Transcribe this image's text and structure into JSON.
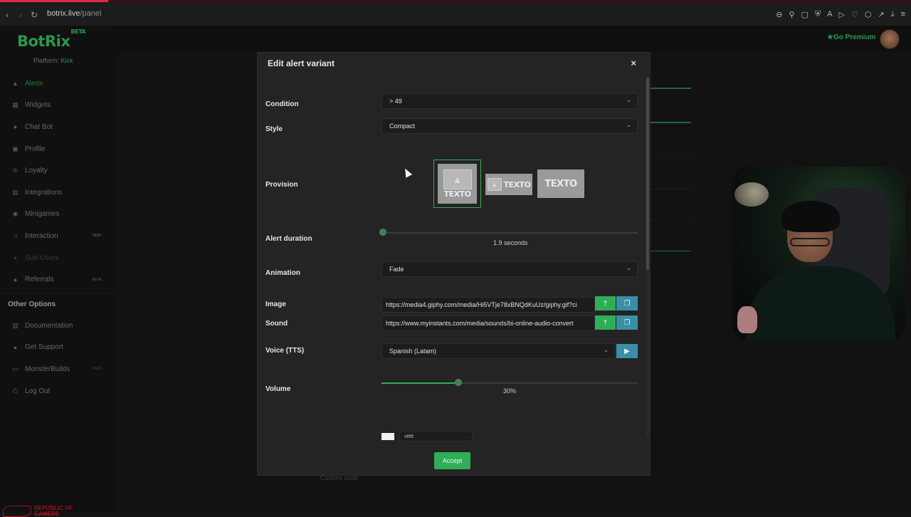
{
  "browser": {
    "url_host": "botrix.live",
    "url_path": "/panel"
  },
  "app": {
    "logo": "BotRix",
    "logo_badge": "BETA",
    "platform_label": "Platform:",
    "platform_value": "Kick",
    "go_premium": "Go Premium"
  },
  "sidebar": {
    "items": [
      {
        "label": "Alerts",
        "icon": "triangle-icon",
        "state": "active"
      },
      {
        "label": "Widgets",
        "icon": "widgets-icon"
      },
      {
        "label": "Chat Bot",
        "icon": "chat-icon"
      },
      {
        "label": "Profile",
        "icon": "profile-icon"
      },
      {
        "label": "Loyalty",
        "icon": "trophy-icon"
      },
      {
        "label": "Integrations",
        "icon": "integrations-icon"
      },
      {
        "label": "Minigames",
        "icon": "gamepad-icon"
      },
      {
        "label": "Interaction",
        "icon": "music-icon",
        "tag": "NEW"
      },
      {
        "label": "Sub-Users",
        "icon": "users-icon",
        "state": "dim"
      },
      {
        "label": "Referrals",
        "icon": "referrals-icon",
        "tag": "BETA"
      }
    ],
    "other_title": "Other Options",
    "other_items": [
      {
        "label": "Documentation",
        "icon": "document-icon"
      },
      {
        "label": "Get Support",
        "icon": "support-icon"
      },
      {
        "label": "MonsterBuilds",
        "icon": "monitor-icon",
        "tag": "ASUS"
      },
      {
        "label": "Log Out",
        "icon": "power-icon"
      }
    ]
  },
  "background": {
    "custom_code": "Custom code"
  },
  "modal": {
    "title": "Edit alert variant",
    "close": "×",
    "condition_label": "Condition",
    "condition_value": "> 49",
    "style_label": "Style",
    "style_value": "Compact",
    "provision_label": "Provision",
    "provision_cards": [
      "TEXTO",
      "TEXTO",
      "TEXTO"
    ],
    "duration_label": "Alert duration",
    "duration_value": "1.9 seconds",
    "duration_fraction": 0.0,
    "animation_label": "Animation",
    "animation_value": "Fade",
    "image_label": "Image",
    "image_url": "https://media4.giphy.com/media/Hi5VTje78xBNQdKuUz/giphy.gif?ci",
    "sound_label": "Sound",
    "sound_url": "https://www.myinstants.com/media/sounds/bi-online-audio-convert",
    "voice_label": "Voice (TTS)",
    "voice_value": "Spanish (Latam)",
    "volume_label": "Volume",
    "volume_value": "30%",
    "volume_fraction": 0.3,
    "text_color_value": "#ffffff",
    "accept": "Accept"
  },
  "colors": {
    "accent": "#2fae57",
    "blue_button": "#3a8fa8"
  }
}
